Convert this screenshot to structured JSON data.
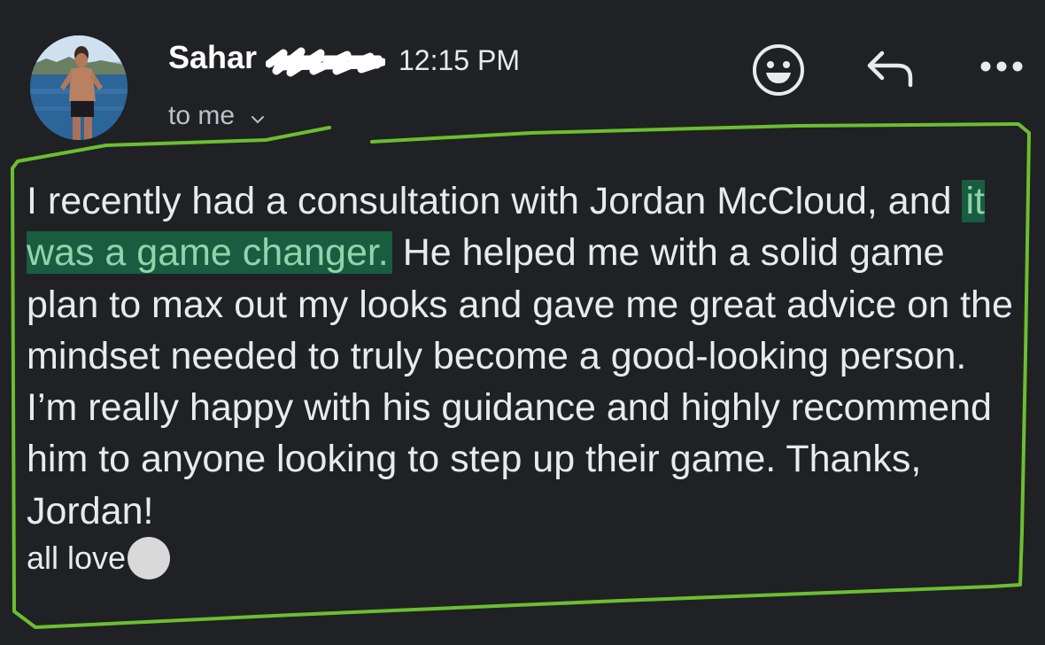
{
  "email": {
    "sender_name": "Sahar",
    "time": "12:15 PM",
    "recipient": "to me",
    "body": {
      "before_highlight": "I recently had a consultation with Jordan McCloud, and ",
      "highlight": "it was a game changer.",
      "after_highlight": " He helped me with a solid game plan to max out my looks and gave me great advice on the mindset needed to truly become a good-looking person. I’m really happy with his guidance and highly recommend him to anyone looking to step up their game. Thanks, Jordan!"
    },
    "signoff": "all love"
  },
  "icons": {
    "emoji": "smiley-face-icon",
    "reply": "reply-arrow-icon",
    "more": "more-options-icon",
    "expand": "chevron-down-icon"
  },
  "colors": {
    "background": "#202124",
    "text": "#e8eaed",
    "highlight_bg": "#185d40",
    "highlight_text": "#8fd4aa",
    "annotation": "#6cbe2f",
    "redaction": "#ffffff"
  }
}
